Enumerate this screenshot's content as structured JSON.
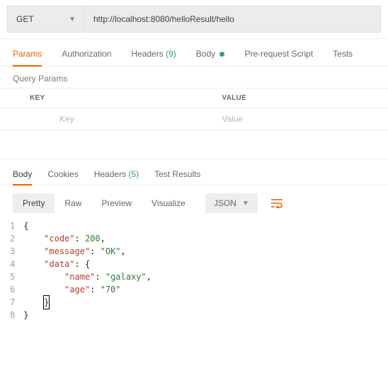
{
  "request": {
    "method": "GET",
    "url": "http://localhost:8080/helloResult/hello"
  },
  "request_tabs": [
    {
      "label": "Params",
      "active": true
    },
    {
      "label": "Authorization"
    },
    {
      "label_prefix": "Headers",
      "count": "(9)"
    },
    {
      "label": "Body",
      "dot": true
    },
    {
      "label": "Pre-request Script"
    },
    {
      "label": "Tests"
    }
  ],
  "query_section_label": "Query Params",
  "table": {
    "key_header": "KEY",
    "value_header": "VALUE",
    "key_placeholder": "Key",
    "value_placeholder": "Value"
  },
  "response_tabs": [
    {
      "label": "Body",
      "active": true
    },
    {
      "label": "Cookies"
    },
    {
      "label_prefix": "Headers",
      "count": "(5)"
    },
    {
      "label": "Test Results"
    }
  ],
  "viewbar": {
    "modes": {
      "pretty": "Pretty",
      "raw": "Raw",
      "preview": "Preview",
      "visualize": "Visualize"
    },
    "type": "JSON"
  },
  "code": {
    "ln1": "1",
    "ln2": "2",
    "ln3": "3",
    "ln4": "4",
    "ln5": "5",
    "ln6": "6",
    "ln7": "7",
    "ln8": "8",
    "l1": "{",
    "l2_k": "\"code\"",
    "l2_c": ": ",
    "l2_v": "200",
    "l2_t": ",",
    "l3_k": "\"message\"",
    "l3_c": ": ",
    "l3_v": "\"OK\"",
    "l3_t": ",",
    "l4_k": "\"data\"",
    "l4_c": ": ",
    "l4_v": "{",
    "l5_k": "\"name\"",
    "l5_c": ": ",
    "l5_v": "\"galaxy\"",
    "l5_t": ",",
    "l6_k": "\"age\"",
    "l6_c": ": ",
    "l6_v": "\"70\"",
    "l7": "}",
    "l8": "}"
  },
  "chart_data": {
    "type": "table",
    "title": "JSON response body",
    "data": {
      "code": 200,
      "message": "OK",
      "data": {
        "name": "galaxy",
        "age": "70"
      }
    }
  }
}
